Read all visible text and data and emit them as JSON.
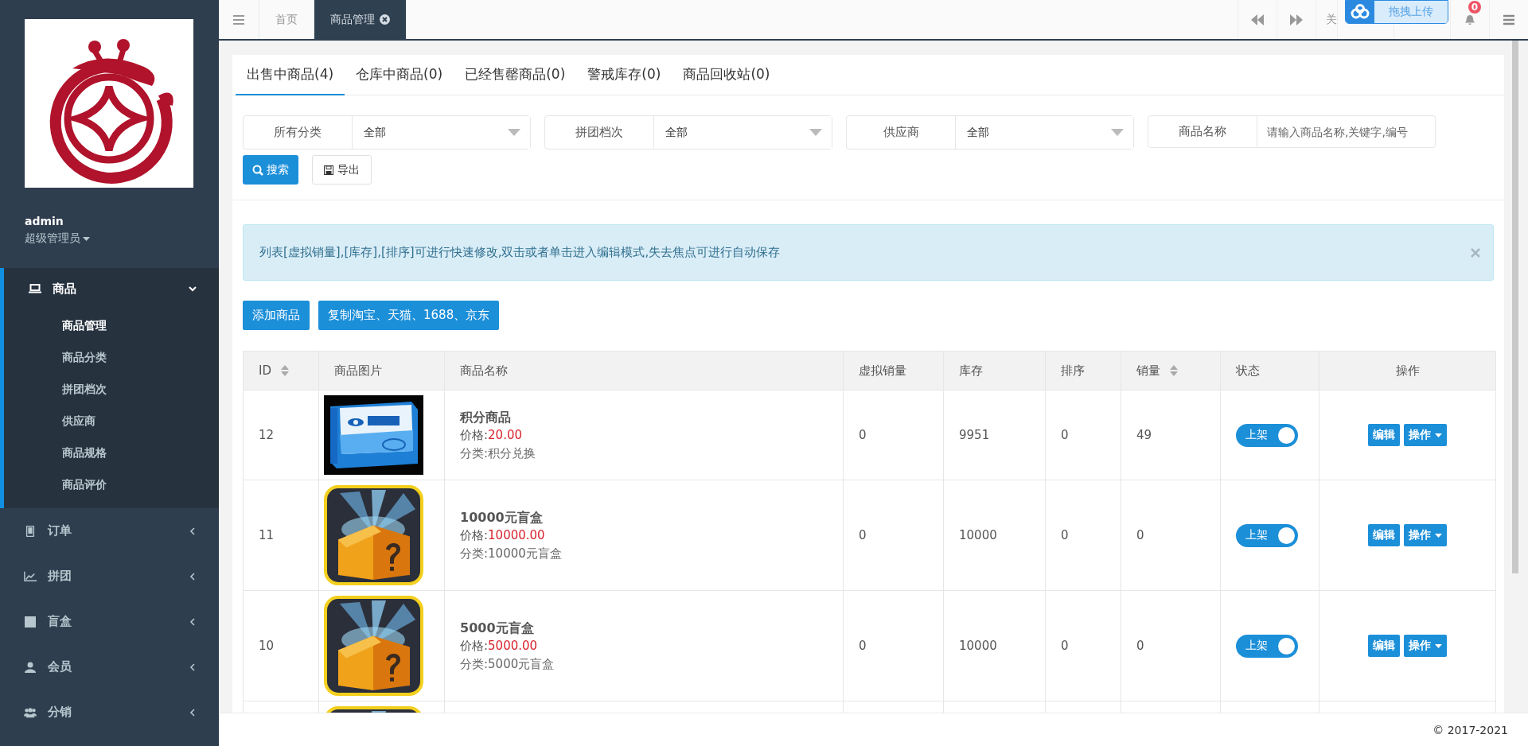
{
  "topbar": {
    "tabs": [
      {
        "label": "首页",
        "selected": false
      },
      {
        "label": "商品管理",
        "selected": true
      }
    ],
    "close_label": "关",
    "notification_count": "0",
    "upload_widget": {
      "label": "拖拽上传"
    }
  },
  "sidebar": {
    "user": {
      "name": "admin",
      "role": "超级管理员"
    },
    "menu": [
      {
        "label": "商品",
        "expanded": true,
        "children": [
          {
            "label": "商品管理",
            "selected": true
          },
          {
            "label": "商品分类",
            "selected": false
          },
          {
            "label": "拼团档次",
            "selected": false
          },
          {
            "label": "供应商",
            "selected": false
          },
          {
            "label": "商品规格",
            "selected": false
          },
          {
            "label": "商品评价",
            "selected": false
          }
        ]
      },
      {
        "label": "订单",
        "expanded": false
      },
      {
        "label": "拼团",
        "expanded": false
      },
      {
        "label": "盲盒",
        "expanded": false
      },
      {
        "label": "会员",
        "expanded": false
      },
      {
        "label": "分销",
        "expanded": false
      }
    ]
  },
  "content": {
    "tabs": [
      {
        "label": "出售中商品(4)",
        "selected": true
      },
      {
        "label": "仓库中商品(0)",
        "selected": false
      },
      {
        "label": "已经售罄商品(0)",
        "selected": false
      },
      {
        "label": "警戒库存(0)",
        "selected": false
      },
      {
        "label": "商品回收站(0)",
        "selected": false
      }
    ],
    "filters": [
      {
        "kind": "select",
        "label": "所有分类",
        "value": "全部"
      },
      {
        "kind": "select",
        "label": "拼团档次",
        "value": "全部"
      },
      {
        "kind": "select",
        "label": "供应商",
        "value": "全部"
      },
      {
        "kind": "text",
        "label": "商品名称",
        "placeholder": "请输入商品名称,关键字,编号"
      }
    ],
    "search_button": "搜索",
    "export_button": "导出",
    "alert": {
      "text": "列表[虚拟销量],[库存],[排序]可进行快速修改,双击或者单击进入编辑模式,失去焦点可进行自动保存"
    },
    "actions": [
      "添加商品",
      "复制淘宝、天猫、1688、京东"
    ],
    "table": {
      "columns": [
        {
          "label": "ID",
          "sortable": true
        },
        {
          "label": "商品图片",
          "sortable": false
        },
        {
          "label": "商品名称",
          "sortable": false
        },
        {
          "label": "虚拟销量",
          "sortable": false
        },
        {
          "label": "库存",
          "sortable": false
        },
        {
          "label": "排序",
          "sortable": false
        },
        {
          "label": "销量",
          "sortable": true
        },
        {
          "label": "状态",
          "sortable": false
        },
        {
          "label": "操作",
          "sortable": false
        }
      ],
      "rows": [
        {
          "id": "12",
          "image": {
            "kind": "picture"
          },
          "name": "积分商品",
          "price_label": "价格:",
          "price": "20.00",
          "category": "分类:积分兑换",
          "virtual_sales": "0",
          "stock": "9951",
          "sort": "0",
          "sales": "49",
          "status": {
            "label": "上架",
            "on": true
          },
          "edit": "编辑",
          "more": "操作"
        },
        {
          "id": "11",
          "image": {
            "kind": "picture"
          },
          "name": "10000元盲盒",
          "price_label": "价格:",
          "price": "10000.00",
          "category": "分类:10000元盲盒",
          "virtual_sales": "0",
          "stock": "10000",
          "sort": "0",
          "sales": "0",
          "status": {
            "label": "上架",
            "on": true
          },
          "edit": "编辑",
          "more": "操作"
        },
        {
          "id": "10",
          "image": {
            "kind": "picture"
          },
          "name": "5000元盲盒",
          "price_label": "价格:",
          "price": "5000.00",
          "category": "分类:5000元盲盒",
          "virtual_sales": "0",
          "stock": "10000",
          "sort": "0",
          "sales": "0",
          "status": {
            "label": "上架",
            "on": true
          },
          "edit": "编辑",
          "more": "操作"
        },
        {
          "image": {
            "kind": "picture"
          }
        }
      ]
    }
  },
  "footer": {
    "copyright": "© 2017-2021"
  }
}
